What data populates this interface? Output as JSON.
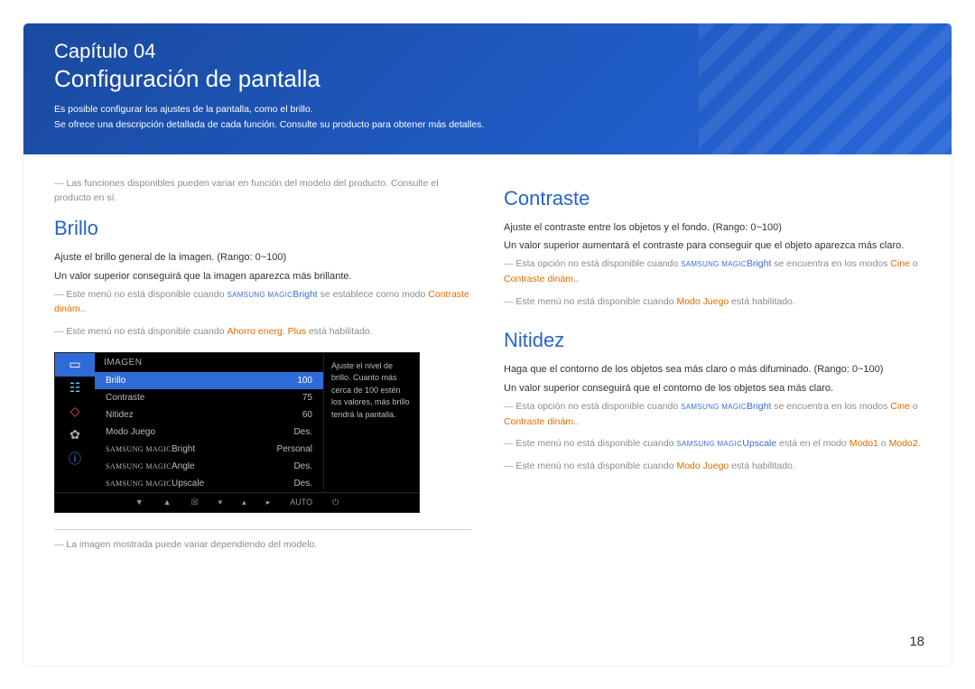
{
  "header": {
    "chapter": "Capítulo 04",
    "title": "Configuración de pantalla",
    "p1": "Es posible configurar los ajustes de la pantalla, como el brillo.",
    "p2": "Se ofrece una descripción detallada de cada función. Consulte su producto para obtener más detalles."
  },
  "left": {
    "topnote": "Las funciones disponibles pueden variar en función del modelo del producto. Consulte el producto en sí.",
    "h": "Brillo",
    "p1": "Ajuste el brillo general de la imagen. (Rango: 0~100)",
    "p2": "Un valor superior conseguirá que la imagen aparezca más brillante.",
    "n1_a": "Este menú no está disponible cuando ",
    "n1_m": "SAMSUNG MAGIC",
    "n1_b": "Bright",
    "n1_c": " se establece como modo ",
    "n1_d": "Contraste dinám.",
    "n2_a": "Este menú no está disponible cuando ",
    "n2_b": "Ahorro energ. Plus",
    "n2_c": " está habilitado.",
    "imgnote": "La imagen mostrada puede variar dependiendo del modelo."
  },
  "osd": {
    "title": "IMAGEN",
    "rows": [
      {
        "l": "Brillo",
        "v": "100",
        "sel": true
      },
      {
        "l": "Contraste",
        "v": "75"
      },
      {
        "l": "Nitidez",
        "v": "60"
      },
      {
        "l": "Modo Juego",
        "v": "Des."
      },
      {
        "l": "SAMSUNG MAGIC Bright",
        "v": "Personal",
        "magic": true
      },
      {
        "l": "SAMSUNG MAGIC Angle",
        "v": "Des.",
        "magic": true
      },
      {
        "l": "SAMSUNG MAGIC Upscale",
        "v": "Des.",
        "magic": true
      }
    ],
    "help": "Ajuste el nivel de brillo. Cuanto más cerca de 100 estén los valores, más brillo tendrá la pantalla.",
    "foot_auto": "AUTO"
  },
  "right": {
    "h1": "Contraste",
    "c_p1": "Ajuste el contraste entre los objetos y el fondo. (Rango: 0~100)",
    "c_p2": "Un valor superior aumentará el contraste para conseguir que el objeto aparezca más claro.",
    "c_n1_a": "Esta opción no está disponible cuando ",
    "c_n1_m1": "SAMSUNG MAGIC",
    "c_n1_b": "Bright",
    "c_n1_c": " se encuentra en los modos ",
    "c_n1_d": "Cine",
    "c_n1_e": " o ",
    "c_n1_f": "Contraste dinám.",
    "c_n2_a": "Este menú no está disponible cuando ",
    "c_n2_b": "Modo Juego",
    "c_n2_c": " está habilitado.",
    "h2": "Nitidez",
    "n_p1": "Haga que el contorno de los objetos sea más claro o más difuminado. (Rango: 0~100)",
    "n_p2": "Un valor superior conseguirá que el contorno de los objetos sea más claro.",
    "n_n1_a": "Esta opción no está disponible cuando ",
    "n_n1_m": "SAMSUNG MAGIC",
    "n_n1_b": "Bright",
    "n_n1_c": " se encuentra en los modos ",
    "n_n1_d": "Cine",
    "n_n1_e": " o ",
    "n_n1_f": "Contraste dinám.",
    "n_n2_a": "Este menú no está disponible cuando ",
    "n_n2_m": "SAMSUNG MAGIC",
    "n_n2_b": "Upscale",
    "n_n2_c": " está en el modo ",
    "n_n2_d": "Modo1",
    "n_n2_e": " o ",
    "n_n2_f": "Modo2",
    "n_n3_a": "Este menú no está disponible cuando ",
    "n_n3_b": "Modo Juego",
    "n_n3_c": " está habilitado."
  },
  "pnum": "18"
}
